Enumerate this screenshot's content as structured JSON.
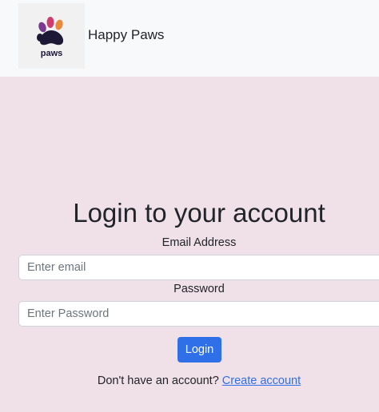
{
  "header": {
    "logo_text": "paws",
    "brand": "Happy Paws"
  },
  "login": {
    "title": "Login to your account",
    "email_label": "Email Address",
    "email_placeholder": "Enter email",
    "email_value": "",
    "password_label": "Password",
    "password_placeholder": "Enter Password",
    "password_value": "",
    "submit_label": "Login",
    "signup_prompt": "Don't have an account?",
    "signup_link": "Create account"
  },
  "colors": {
    "page_bg": "#efe1e7",
    "accent": "#2f6fe8",
    "paw_pink": "#cc3c6e",
    "paw_purple": "#7a3a8f",
    "paw_orange": "#e88a3c",
    "paw_dark": "#1c1836"
  }
}
